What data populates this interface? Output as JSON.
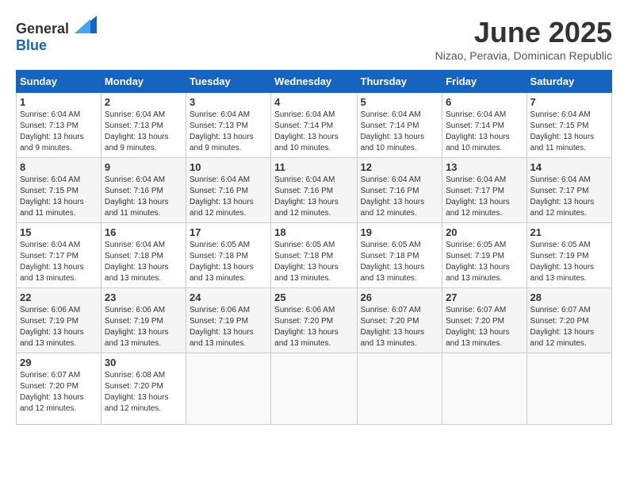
{
  "logo": {
    "general": "General",
    "blue": "Blue"
  },
  "title": "June 2025",
  "location": "Nizao, Peravia, Dominican Republic",
  "weekdays": [
    "Sunday",
    "Monday",
    "Tuesday",
    "Wednesday",
    "Thursday",
    "Friday",
    "Saturday"
  ],
  "weeks": [
    [
      {
        "day": "1",
        "sunrise": "6:04 AM",
        "sunset": "7:13 PM",
        "daylight": "13 hours and 9 minutes."
      },
      {
        "day": "2",
        "sunrise": "6:04 AM",
        "sunset": "7:13 PM",
        "daylight": "13 hours and 9 minutes."
      },
      {
        "day": "3",
        "sunrise": "6:04 AM",
        "sunset": "7:13 PM",
        "daylight": "13 hours and 9 minutes."
      },
      {
        "day": "4",
        "sunrise": "6:04 AM",
        "sunset": "7:14 PM",
        "daylight": "13 hours and 10 minutes."
      },
      {
        "day": "5",
        "sunrise": "6:04 AM",
        "sunset": "7:14 PM",
        "daylight": "13 hours and 10 minutes."
      },
      {
        "day": "6",
        "sunrise": "6:04 AM",
        "sunset": "7:14 PM",
        "daylight": "13 hours and 10 minutes."
      },
      {
        "day": "7",
        "sunrise": "6:04 AM",
        "sunset": "7:15 PM",
        "daylight": "13 hours and 11 minutes."
      }
    ],
    [
      {
        "day": "8",
        "sunrise": "6:04 AM",
        "sunset": "7:15 PM",
        "daylight": "13 hours and 11 minutes."
      },
      {
        "day": "9",
        "sunrise": "6:04 AM",
        "sunset": "7:16 PM",
        "daylight": "13 hours and 11 minutes."
      },
      {
        "day": "10",
        "sunrise": "6:04 AM",
        "sunset": "7:16 PM",
        "daylight": "13 hours and 12 minutes."
      },
      {
        "day": "11",
        "sunrise": "6:04 AM",
        "sunset": "7:16 PM",
        "daylight": "13 hours and 12 minutes."
      },
      {
        "day": "12",
        "sunrise": "6:04 AM",
        "sunset": "7:16 PM",
        "daylight": "13 hours and 12 minutes."
      },
      {
        "day": "13",
        "sunrise": "6:04 AM",
        "sunset": "7:17 PM",
        "daylight": "13 hours and 12 minutes."
      },
      {
        "day": "14",
        "sunrise": "6:04 AM",
        "sunset": "7:17 PM",
        "daylight": "13 hours and 12 minutes."
      }
    ],
    [
      {
        "day": "15",
        "sunrise": "6:04 AM",
        "sunset": "7:17 PM",
        "daylight": "13 hours and 13 minutes."
      },
      {
        "day": "16",
        "sunrise": "6:04 AM",
        "sunset": "7:18 PM",
        "daylight": "13 hours and 13 minutes."
      },
      {
        "day": "17",
        "sunrise": "6:05 AM",
        "sunset": "7:18 PM",
        "daylight": "13 hours and 13 minutes."
      },
      {
        "day": "18",
        "sunrise": "6:05 AM",
        "sunset": "7:18 PM",
        "daylight": "13 hours and 13 minutes."
      },
      {
        "day": "19",
        "sunrise": "6:05 AM",
        "sunset": "7:18 PM",
        "daylight": "13 hours and 13 minutes."
      },
      {
        "day": "20",
        "sunrise": "6:05 AM",
        "sunset": "7:19 PM",
        "daylight": "13 hours and 13 minutes."
      },
      {
        "day": "21",
        "sunrise": "6:05 AM",
        "sunset": "7:19 PM",
        "daylight": "13 hours and 13 minutes."
      }
    ],
    [
      {
        "day": "22",
        "sunrise": "6:06 AM",
        "sunset": "7:19 PM",
        "daylight": "13 hours and 13 minutes."
      },
      {
        "day": "23",
        "sunrise": "6:06 AM",
        "sunset": "7:19 PM",
        "daylight": "13 hours and 13 minutes."
      },
      {
        "day": "24",
        "sunrise": "6:06 AM",
        "sunset": "7:19 PM",
        "daylight": "13 hours and 13 minutes."
      },
      {
        "day": "25",
        "sunrise": "6:06 AM",
        "sunset": "7:20 PM",
        "daylight": "13 hours and 13 minutes."
      },
      {
        "day": "26",
        "sunrise": "6:07 AM",
        "sunset": "7:20 PM",
        "daylight": "13 hours and 13 minutes."
      },
      {
        "day": "27",
        "sunrise": "6:07 AM",
        "sunset": "7:20 PM",
        "daylight": "13 hours and 13 minutes."
      },
      {
        "day": "28",
        "sunrise": "6:07 AM",
        "sunset": "7:20 PM",
        "daylight": "13 hours and 12 minutes."
      }
    ],
    [
      {
        "day": "29",
        "sunrise": "6:07 AM",
        "sunset": "7:20 PM",
        "daylight": "13 hours and 12 minutes."
      },
      {
        "day": "30",
        "sunrise": "6:08 AM",
        "sunset": "7:20 PM",
        "daylight": "13 hours and 12 minutes."
      },
      null,
      null,
      null,
      null,
      null
    ]
  ],
  "labels": {
    "sunrise": "Sunrise:",
    "sunset": "Sunset:",
    "daylight": "Daylight:"
  }
}
